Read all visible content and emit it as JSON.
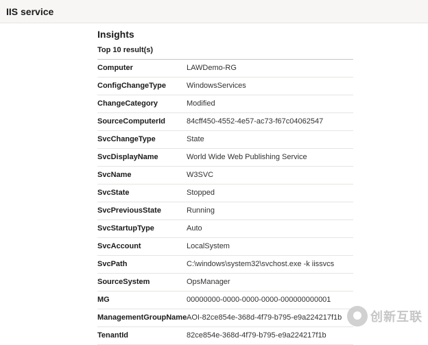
{
  "header": {
    "title": "IIS service"
  },
  "insights": {
    "title": "Insights",
    "results_count": "Top 10 result(s)"
  },
  "rows": [
    {
      "key": "Computer",
      "value": "LAWDemo-RG"
    },
    {
      "key": "ConfigChangeType",
      "value": "WindowsServices"
    },
    {
      "key": "ChangeCategory",
      "value": "Modified"
    },
    {
      "key": "SourceComputerId",
      "value": "84cff450-4552-4e57-ac73-f67c04062547"
    },
    {
      "key": "SvcChangeType",
      "value": "State"
    },
    {
      "key": "SvcDisplayName",
      "value": "World Wide Web Publishing Service"
    },
    {
      "key": "SvcName",
      "value": "W3SVC"
    },
    {
      "key": "SvcState",
      "value": "Stopped"
    },
    {
      "key": "SvcPreviousState",
      "value": "Running"
    },
    {
      "key": "SvcStartupType",
      "value": "Auto"
    },
    {
      "key": "SvcAccount",
      "value": "LocalSystem"
    },
    {
      "key": "SvcPath",
      "value": "C:\\windows\\system32\\svchost.exe -k iissvcs"
    },
    {
      "key": "SourceSystem",
      "value": "OpsManager"
    },
    {
      "key": "MG",
      "value": "00000000-0000-0000-0000-000000000001"
    },
    {
      "key": "ManagementGroupName",
      "value": "AOI-82ce854e-368d-4f79-b795-e9a224217f1b"
    },
    {
      "key": "TenantId",
      "value": "82ce854e-368d-4f79-b795-e9a224217f1b"
    }
  ],
  "watermark": {
    "text": "创新互联"
  }
}
